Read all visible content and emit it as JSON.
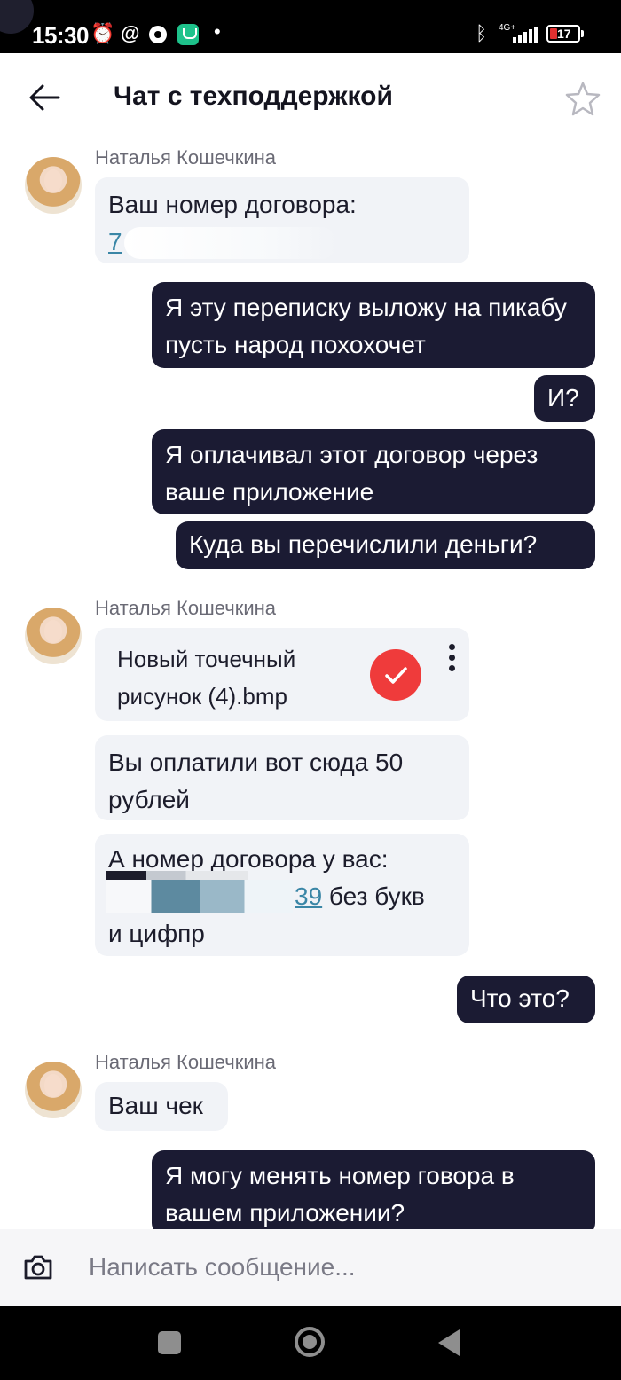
{
  "status_bar": {
    "time": "15:30",
    "network": "4G+",
    "battery": "17",
    "dot": "•"
  },
  "header": {
    "title": "Чат с техподдержкой"
  },
  "messages": {
    "sender_name": "Наталья Кошечкина",
    "m1_line1": "Ваш номер договора:",
    "m1_line2_partial": "7",
    "m2": "Я эту переписку выложу на пикабу пусть народ похохочет",
    "m3": "И?",
    "m4": "Я оплачивал этот договор через ваше приложение",
    "m5": "Куда вы перечислили деньги?",
    "file_name": "Новый точечный рисунок (4).bmp",
    "m7": "Вы оплатили вот сюда 50 рублей",
    "m8_line1": "А номер договора у вас:",
    "m8_link_fragment": "39",
    "m8_after_link": " без букв",
    "m8_line3": "и цифпр",
    "m9": "Что это?",
    "m10": "Ваш чек",
    "m11": "Я могу менять номер говора в вашем приложении?"
  },
  "composer": {
    "placeholder": "Написать сообщение..."
  },
  "colors": {
    "outgoing_bubble": "#1b1b33",
    "incoming_bubble": "#f1f3f7",
    "file_check": "#ef3b3b",
    "link": "#3a86a6"
  }
}
